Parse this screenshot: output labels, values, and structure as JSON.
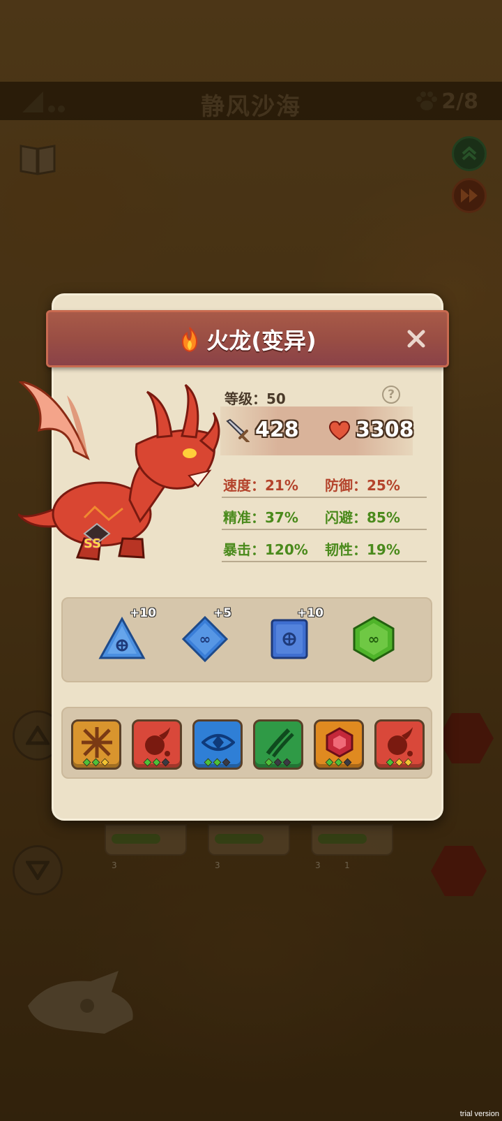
{
  "hud": {
    "stage_title": "静风沙海",
    "paw_count": "2/8",
    "watermark": "trial version",
    "bench": [
      {
        "level": "3"
      },
      {
        "level": "3"
      },
      {
        "level": "3",
        "badge": "1"
      }
    ]
  },
  "dialog": {
    "title": "火龙(变异)",
    "rank_badge": "SS",
    "level_label": "等级：50",
    "attack": "428",
    "health": "3308",
    "stats": [
      {
        "left_key": "速度：",
        "left_value": "21%",
        "right_key": "防御：",
        "right_value": "25%",
        "tone": "red"
      },
      {
        "left_key": "精准：",
        "left_value": "37%",
        "right_key": "闪避：",
        "right_value": "85%",
        "tone": "green"
      },
      {
        "left_key": "暴击：",
        "left_value": "120%",
        "right_key": "韧性：",
        "right_value": "19%",
        "tone": "green"
      }
    ],
    "gems": [
      {
        "name": "blue-triangle-gem",
        "bonus": "+10",
        "color": "#4a8fe0"
      },
      {
        "name": "blue-diamond-gem",
        "bonus": "+5",
        "color": "#3a7ed8"
      },
      {
        "name": "blue-square-gem",
        "bonus": "+10",
        "color": "#3f6fd0"
      },
      {
        "name": "green-hexagon-gem",
        "bonus": "",
        "color": "#4fb42a"
      }
    ],
    "skills": [
      {
        "name": "claw-strike-skill",
        "color": "#d9952e",
        "pips": [
          "g",
          "g",
          "y"
        ]
      },
      {
        "name": "fire-drop-skill",
        "color": "#d9483a",
        "pips": [
          "g",
          "g",
          "d"
        ]
      },
      {
        "name": "eye-sight-skill",
        "color": "#2f7fd6",
        "pips": [
          "g",
          "g",
          "d"
        ]
      },
      {
        "name": "slash-skill",
        "color": "#2f9a46",
        "pips": [
          "g",
          "d",
          "d"
        ]
      },
      {
        "name": "shield-gem-skill",
        "color": "#e08a20",
        "pips": [
          "g",
          "g",
          "d"
        ]
      },
      {
        "name": "fire-drop-skill-2",
        "color": "#d9483a",
        "pips": [
          "g",
          "y",
          "y"
        ]
      }
    ]
  }
}
